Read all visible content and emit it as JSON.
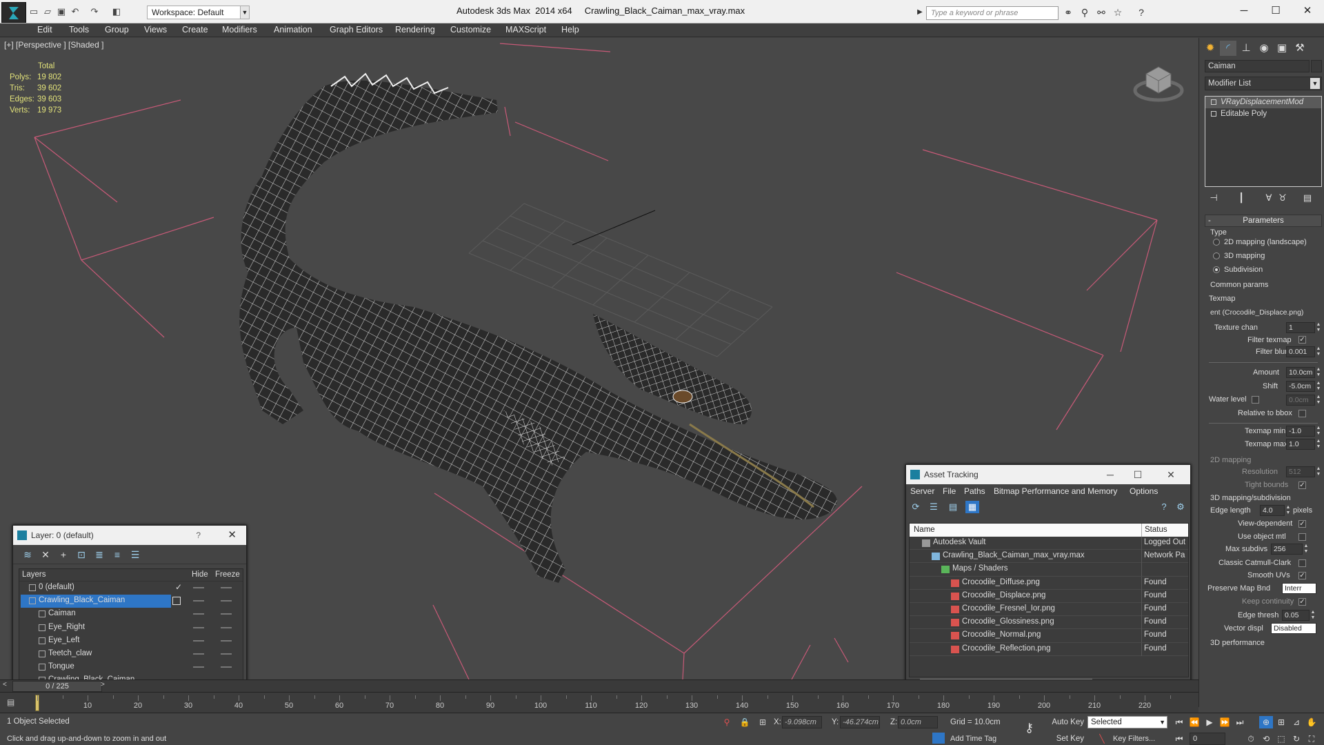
{
  "titlebar": {
    "workspace": "Workspace: Default",
    "app_name": "Autodesk 3ds Max  2014 x64",
    "file_name": "Crawling_Black_Caiman_max_vray.max",
    "search_placeholder": "Type a keyword or phrase"
  },
  "menu": [
    "Edit",
    "Tools",
    "Group",
    "Views",
    "Create",
    "Modifiers",
    "Animation",
    "Graph Editors",
    "Rendering",
    "Customize",
    "MAXScript",
    "Help"
  ],
  "viewport": {
    "label": "[+] [Perspective ] [Shaded ]",
    "stats": {
      "total_label": "Total",
      "polys_label": "Polys:",
      "polys": "19 802",
      "tris_label": "Tris:",
      "tris": "39 602",
      "edges_label": "Edges:",
      "edges": "39 603",
      "verts_label": "Verts:",
      "verts": "19 973"
    }
  },
  "layer_dialog": {
    "title": "Layer: 0 (default)",
    "help": "?",
    "col_layers": "Layers",
    "col_hide": "Hide",
    "col_freeze": "Freeze",
    "rows": [
      {
        "name": "0 (default)",
        "indent": 0,
        "kind": "layer",
        "current": true,
        "selected": false
      },
      {
        "name": "Crawling_Black_Caiman",
        "indent": 0,
        "kind": "layer",
        "current": false,
        "selected": true
      },
      {
        "name": "Caiman",
        "indent": 1,
        "kind": "object",
        "current": false,
        "selected": false
      },
      {
        "name": "Eye_Right",
        "indent": 1,
        "kind": "object",
        "current": false,
        "selected": false
      },
      {
        "name": "Eye_Left",
        "indent": 1,
        "kind": "object",
        "current": false,
        "selected": false
      },
      {
        "name": "Teetch_claw",
        "indent": 1,
        "kind": "object",
        "current": false,
        "selected": false
      },
      {
        "name": "Tongue",
        "indent": 1,
        "kind": "object",
        "current": false,
        "selected": false
      },
      {
        "name": "Crawling_Black_Caiman",
        "indent": 1,
        "kind": "object",
        "current": false,
        "selected": false
      }
    ]
  },
  "asset_dialog": {
    "title": "Asset Tracking",
    "menu": [
      "Server",
      "File",
      "Paths",
      "Bitmap Performance and Memory",
      "Options"
    ],
    "col_name": "Name",
    "col_status": "Status",
    "rows": [
      {
        "name": "Autodesk Vault",
        "status": "Logged Out",
        "indent": 0,
        "icon": "vault"
      },
      {
        "name": "Crawling_Black_Caiman_max_vray.max",
        "status": "Network Pa",
        "indent": 1,
        "icon": "maxfile"
      },
      {
        "name": "Maps / Shaders",
        "status": "",
        "indent": 2,
        "icon": "maps"
      },
      {
        "name": "Crocodile_Diffuse.png",
        "status": "Found",
        "indent": 3,
        "icon": "png"
      },
      {
        "name": "Crocodile_Displace.png",
        "status": "Found",
        "indent": 3,
        "icon": "png"
      },
      {
        "name": "Crocodile_Fresnel_Ior.png",
        "status": "Found",
        "indent": 3,
        "icon": "png"
      },
      {
        "name": "Crocodile_Glossiness.png",
        "status": "Found",
        "indent": 3,
        "icon": "png"
      },
      {
        "name": "Crocodile_Normal.png",
        "status": "Found",
        "indent": 3,
        "icon": "png"
      },
      {
        "name": "Crocodile_Reflection.png",
        "status": "Found",
        "indent": 3,
        "icon": "png"
      }
    ]
  },
  "command_panel": {
    "object_name": "Caiman",
    "modifier_list": "Modifier List",
    "stack": [
      "VRayDisplacementMod",
      "Editable Poly"
    ],
    "parameters_title": "Parameters",
    "type_label": "Type",
    "type_options": [
      "2D mapping (landscape)",
      "3D mapping",
      "Subdivision"
    ],
    "common_params": "Common params",
    "texmap_label": "Texmap",
    "texmap_value": "ent (Crocodile_Displace.png)",
    "texture_chan_label": "Texture chan",
    "texture_chan": "1",
    "filter_texmap_label": "Filter texmap",
    "filter_blur_label": "Filter blur",
    "filter_blur": "0.001",
    "amount_label": "Amount",
    "amount": "10.0cm",
    "shift_label": "Shift",
    "shift": "-5.0cm",
    "water_level_label": "Water level",
    "water_level": "0.0cm",
    "relative_bbox_label": "Relative to bbox",
    "texmap_min_label": "Texmap min",
    "texmap_min": "-1.0",
    "texmap_max_label": "Texmap max",
    "texmap_max": "1.0",
    "mapping2d_label": "2D mapping",
    "resolution_label": "Resolution",
    "resolution": "512",
    "tight_bounds_label": "Tight bounds",
    "mapping3d_label": "3D mapping/subdivision",
    "edge_length_label": "Edge length",
    "edge_length": "4.0",
    "pixels_label": "pixels",
    "view_dependent_label": "View-dependent",
    "use_object_mtl_label": "Use object mtl",
    "max_subdivs_label": "Max subdivs",
    "max_subdivs": "256",
    "catmull_label": "Classic Catmull-Clark",
    "smooth_uvs_label": "Smooth UVs",
    "preserve_map_label": "Preserve Map Bnd",
    "preserve_map": "Interr",
    "keep_continuity_label": "Keep continuity",
    "edge_thresh_label": "Edge thresh",
    "edge_thresh": "0.05",
    "vector_displ_label": "Vector displ",
    "vector_displ": "Disabled",
    "performance_label": "3D performance"
  },
  "timeline": {
    "frame_display": "0 / 225",
    "ticks": [
      10,
      20,
      30,
      40,
      50,
      60,
      70,
      80,
      90,
      100,
      110,
      120,
      130,
      140,
      150,
      160,
      170,
      180,
      190,
      200,
      210,
      220
    ]
  },
  "statusbar": {
    "selection": "1 Object Selected",
    "prompt": "Click and drag up-and-down to zoom in and out",
    "x_label": "X:",
    "x": "-9.098cm",
    "y_label": "Y:",
    "y": "-46.274cm",
    "z_label": "Z:",
    "z": "0.0cm",
    "grid": "Grid = 10.0cm",
    "add_time_tag": "Add Time Tag",
    "auto_key": "Auto Key",
    "selected": "Selected",
    "set_key": "Set Key",
    "key_filters": "Key Filters...",
    "frame": "0"
  },
  "colors": {
    "stats_text": "#e3e37a",
    "selection_blue": "#2e76c6",
    "grid_pink": "#c85a78",
    "viewport_bg": "#484848"
  }
}
